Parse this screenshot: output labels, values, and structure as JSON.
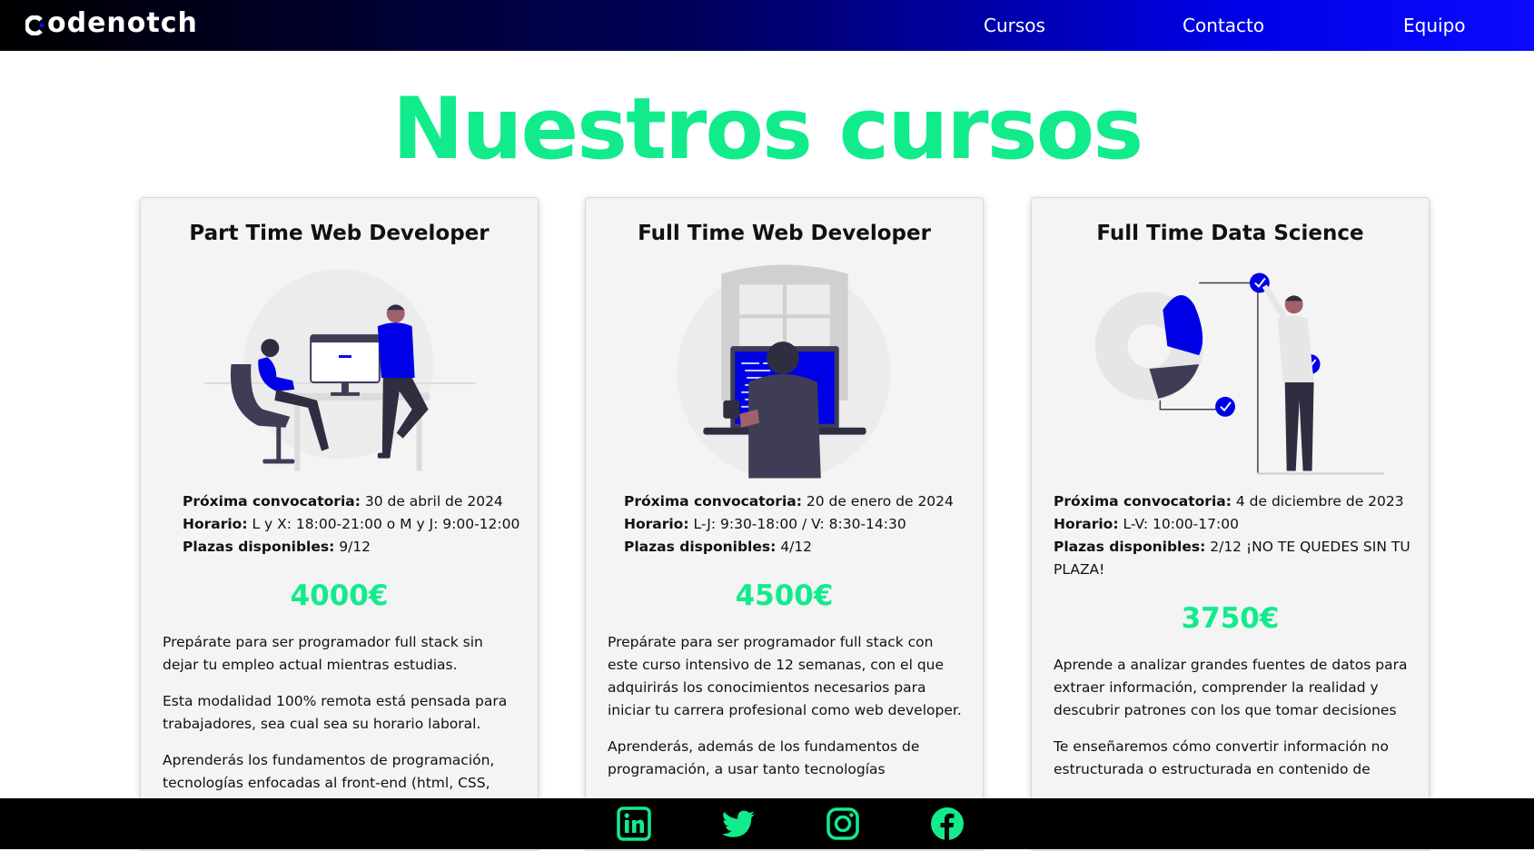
{
  "header": {
    "logo_text": "odenotch",
    "nav": [
      {
        "label": "Cursos"
      },
      {
        "label": "Contacto"
      },
      {
        "label": "Equipo"
      }
    ]
  },
  "main": {
    "title": "Nuestros cursos",
    "courses": [
      {
        "title": "Part Time Web Developer",
        "next_label": "Próxima convocatoria:",
        "next_value": " 30 de abril de 2024",
        "schedule_label": "Horario:",
        "schedule_value": " L y X: 18:00-21:00 o M y J: 9:00-12:00",
        "seats_label": "Plazas disponibles:",
        "seats_value": " 9/12",
        "price": "4000€",
        "paragraphs": [
          "Prepárate para ser programador full stack sin dejar tu empleo actual mientras estudias.",
          "Esta modalidad 100% remota está pensada para trabajadores, sea cual sea su horario laboral.",
          "Aprenderás los fundamentos de programación, tecnologías enfocadas al front-end (html, CSS,"
        ]
      },
      {
        "title": "Full Time Web Developer",
        "next_label": "Próxima convocatoria:",
        "next_value": " 20 de enero de 2024",
        "schedule_label": "Horario:",
        "schedule_value": " L-J: 9:30-18:00 / V: 8:30-14:30",
        "seats_label": "Plazas disponibles:",
        "seats_value": " 4/12",
        "price": "4500€",
        "paragraphs": [
          "Prepárate para ser programador full stack con este curso intensivo de 12 semanas, con el que adquirirás los conocimientos necesarios para iniciar tu carrera profesional como web developer.",
          "Aprenderás, además de los fundamentos de programación, a usar tanto tecnologías"
        ]
      },
      {
        "title": "Full Time Data Science",
        "next_label": "Próxima convocatoria:",
        "next_value": " 4 de diciembre de 2023",
        "schedule_label": "Horario:",
        "schedule_value": " L-V: 10:00-17:00",
        "seats_label": "Plazas disponibles:",
        "seats_value": " 2/12 ¡NO TE QUEDES SIN TU PLAZA!",
        "price": "3750€",
        "paragraphs": [
          "Aprende a analizar grandes fuentes de datos para extraer información, comprender la realidad y descubrir patrones con los que tomar decisiones",
          "Te enseñaremos cómo convertir información no estructurada o estructurada en contenido de"
        ]
      }
    ]
  },
  "footer": {
    "social": [
      {
        "icon": "linkedin-icon"
      },
      {
        "icon": "twitter-icon"
      },
      {
        "icon": "instagram-icon"
      },
      {
        "icon": "facebook-icon"
      }
    ]
  },
  "colors": {
    "accent_green": "#12eb8c",
    "brand_blue": "#0000e6",
    "header_start": "#000000",
    "card_bg": "#f4f4f4"
  }
}
